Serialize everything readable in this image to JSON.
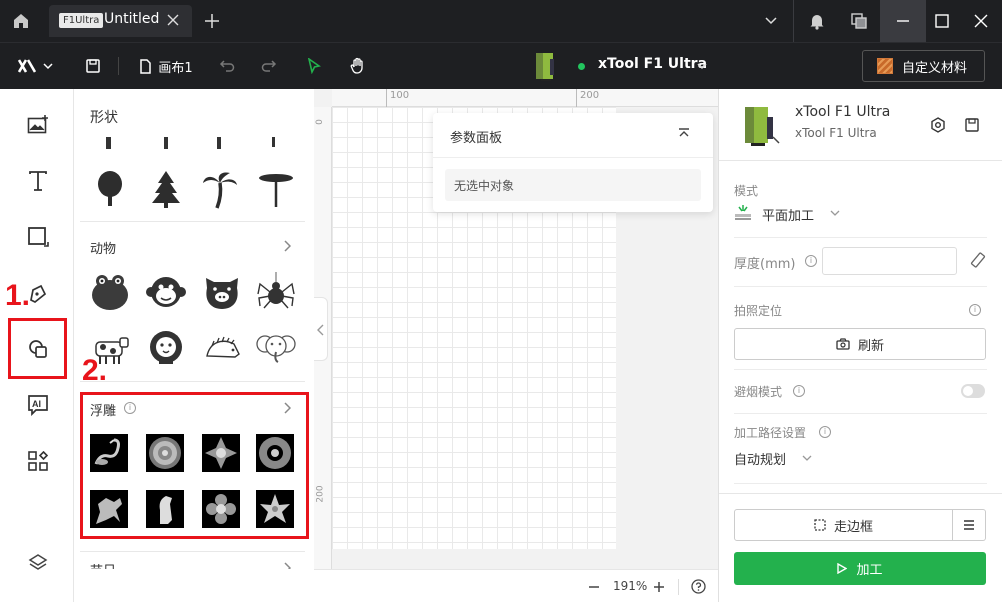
{
  "titlebar": {
    "tab_badge": "F1Ultra",
    "tab_title": "Untitled"
  },
  "toolbar": {
    "canvas_label": "画布1",
    "device_name": "xTool F1 Ultra",
    "device_status_color": "#22c55e",
    "custom_material": "自定义材料"
  },
  "shapes_panel": {
    "title": "形状",
    "animals_title": "动物",
    "relief_title": "浮雕",
    "holiday_title": "节日"
  },
  "canvas": {
    "ruler_top_ticks": [
      "100",
      "200"
    ],
    "ruler_left_ticks": [
      "0",
      "200"
    ],
    "param_panel_title": "参数面板",
    "param_panel_empty": "无选中对象",
    "zoom": "191%"
  },
  "right_panel": {
    "device_name": "xTool F1 Ultra",
    "device_model": "xTool F1 Ultra",
    "mode_label": "模式",
    "mode_value": "平面加工",
    "thickness_label": "厚度(mm)",
    "thickness_value": "",
    "camera_label": "拍照定位",
    "refresh_label": "刷新",
    "smoke_label": "避烟模式",
    "path_label": "加工路径设置",
    "path_value": "自动规划",
    "frame_label": "走边框",
    "process_label": "加工",
    "accent_color": "#23b14d"
  },
  "annotations": {
    "step1": "1.",
    "step2": "2.",
    "color": "#e8141b"
  }
}
